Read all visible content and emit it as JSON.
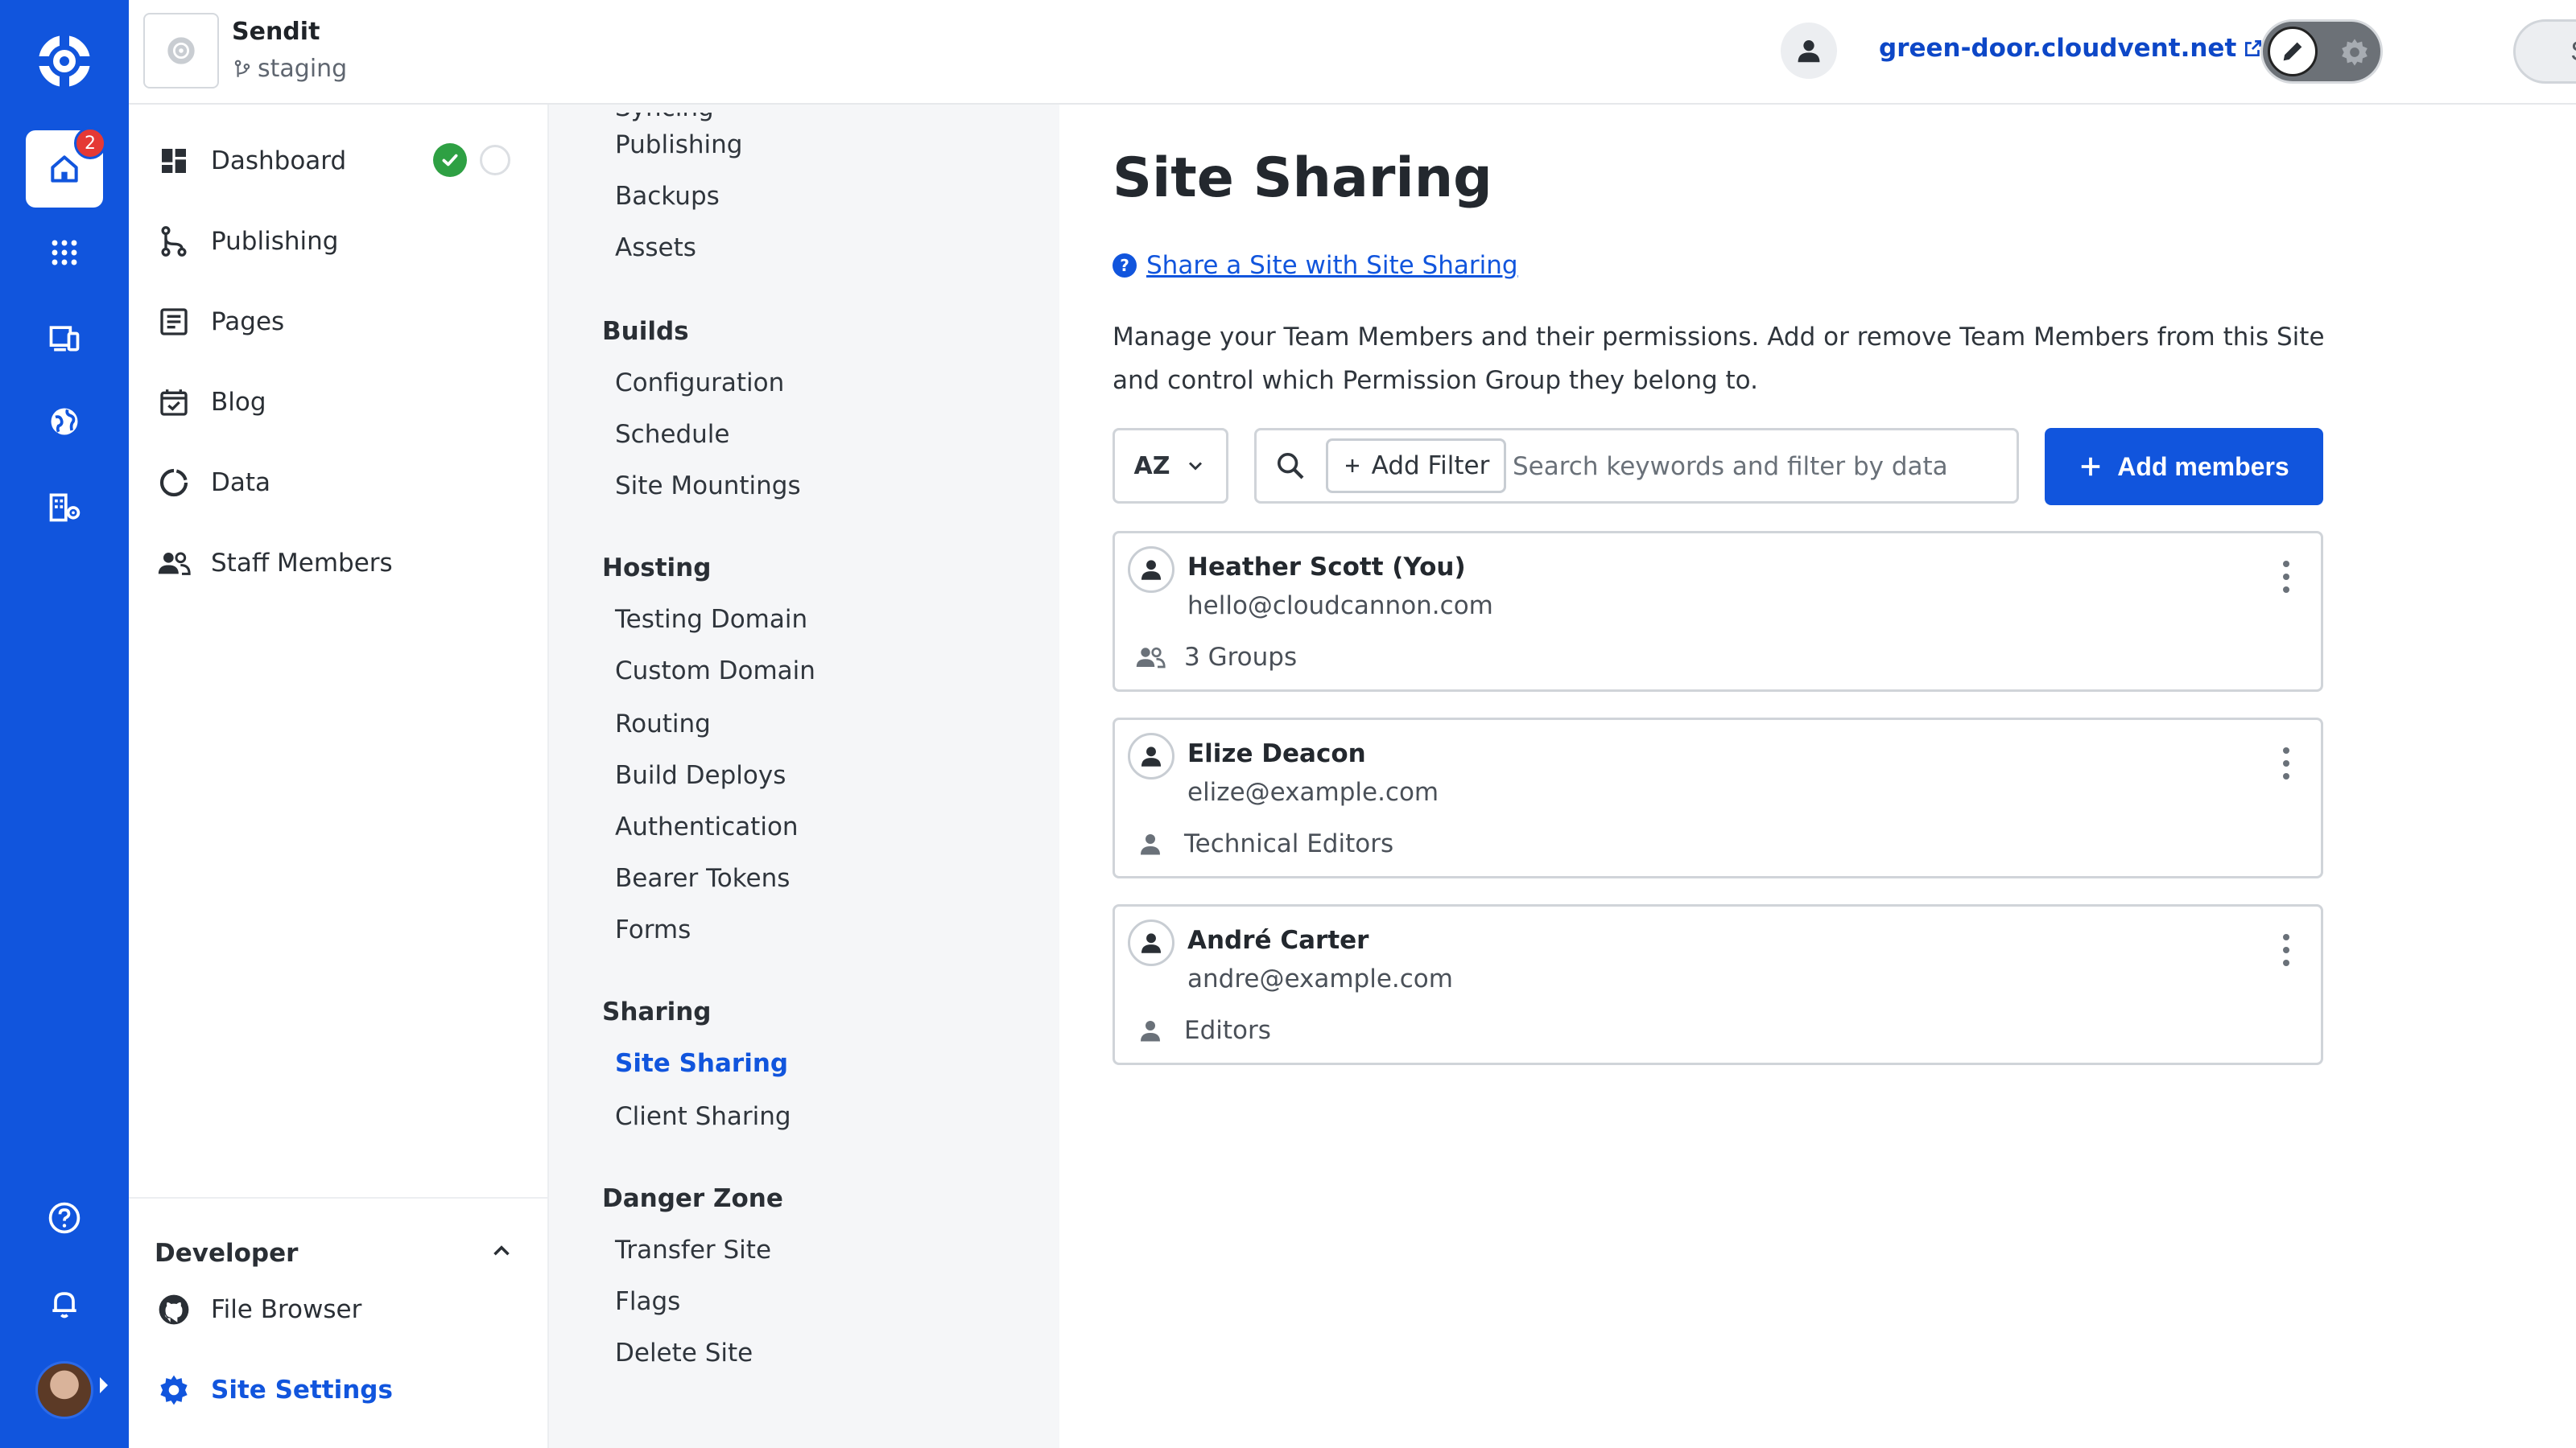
{
  "rail": {
    "notification_count": "2",
    "accent": "#1155dd"
  },
  "topbar": {
    "site_name": "Sendit",
    "branch": "staging",
    "domain": "green-door.cloudvent.net",
    "save_label": "Save"
  },
  "sidebar": {
    "items": [
      {
        "label": "Dashboard",
        "icon": "dashboard-icon"
      },
      {
        "label": "Publishing",
        "icon": "publishing-icon"
      },
      {
        "label": "Pages",
        "icon": "pages-icon"
      },
      {
        "label": "Blog",
        "icon": "blog-icon"
      },
      {
        "label": "Data",
        "icon": "data-icon"
      },
      {
        "label": "Staff Members",
        "icon": "staff-icon"
      }
    ],
    "developer": {
      "title": "Developer",
      "items": [
        {
          "label": "File Browser",
          "icon": "github-icon"
        },
        {
          "label": "Site Settings",
          "icon": "gear-icon"
        }
      ]
    }
  },
  "subnav": {
    "top_items": [
      "Publishing",
      "Backups",
      "Assets"
    ],
    "groups": [
      {
        "title": "Builds",
        "items": [
          "Configuration",
          "Schedule",
          "Site Mountings"
        ]
      },
      {
        "title": "Hosting",
        "items": [
          "Testing Domain",
          "Custom Domain",
          "Routing",
          "Build Deploys",
          "Authentication",
          "Bearer Tokens",
          "Forms"
        ]
      },
      {
        "title": "Sharing",
        "items": [
          "Site Sharing",
          "Client Sharing"
        ]
      },
      {
        "title": "Danger Zone",
        "items": [
          "Transfer Site",
          "Flags",
          "Delete Site"
        ]
      }
    ]
  },
  "main": {
    "title": "Site Sharing",
    "help_link": "Share a Site with Site Sharing",
    "description": "Manage your Team Members and their permissions. Add or remove Team Members from this Site and control which Permission Group they belong to.",
    "sort_label": "AZ",
    "add_filter_label": "Add Filter",
    "search_placeholder": "Search keywords and filter by data",
    "add_members_label": "Add members",
    "members": [
      {
        "name": "Heather Scott (You)",
        "email": "hello@cloudcannon.com",
        "group": "3 Groups"
      },
      {
        "name": "Elize Deacon",
        "email": "elize@example.com",
        "group": "Technical Editors"
      },
      {
        "name": "André Carter",
        "email": "andre@example.com",
        "group": "Editors"
      }
    ]
  }
}
